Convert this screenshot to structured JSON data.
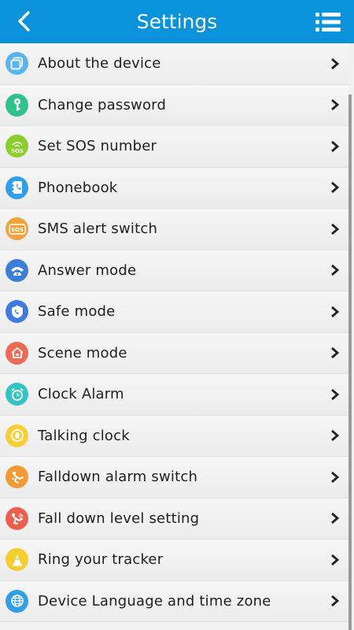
{
  "header": {
    "title": "Settings",
    "back_icon": "chevron-left-icon",
    "menu_icon": "list-menu-icon",
    "color": "#0a93da"
  },
  "items": [
    {
      "label": "About the device",
      "icon": "device-icon",
      "color": "#5bb5ec"
    },
    {
      "label": "Change password",
      "icon": "key-icon",
      "color": "#2fc28a"
    },
    {
      "label": "Set SOS number",
      "icon": "sos-signal-icon",
      "color": "#8ccf2c"
    },
    {
      "label": "Phonebook",
      "icon": "phonebook-icon",
      "color": "#2f9fe8"
    },
    {
      "label": "SMS alert switch",
      "icon": "sms-sos-icon",
      "color": "#f3a13a"
    },
    {
      "label": "Answer mode",
      "icon": "answer-phone-icon",
      "color": "#3c7fd8"
    },
    {
      "label": "Safe mode",
      "icon": "shield-icon",
      "color": "#3d7be0"
    },
    {
      "label": "Scene mode",
      "icon": "home-icon",
      "color": "#ee6a55"
    },
    {
      "label": "Clock Alarm",
      "icon": "alarm-clock-icon",
      "color": "#33c4c4"
    },
    {
      "label": "Talking clock",
      "icon": "talking-clock-icon",
      "color": "#f7cf35"
    },
    {
      "label": "Falldown alarm switch",
      "icon": "falldown-icon",
      "color": "#f39a35"
    },
    {
      "label": "Fall down level setting",
      "icon": "fall-level-icon",
      "color": "#ef5d4d"
    },
    {
      "label": "Ring your tracker",
      "icon": "bell-cone-icon",
      "color": "#f5cd2e"
    },
    {
      "label": "Device Language and time zone",
      "icon": "globe-icon",
      "color": "#2f9fe8"
    }
  ]
}
